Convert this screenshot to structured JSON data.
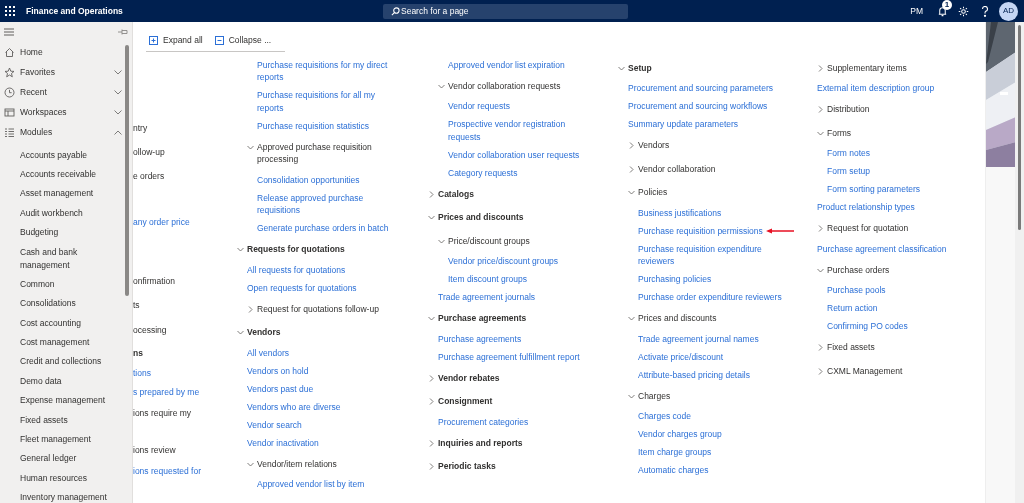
{
  "top_bar": {
    "app_title": "Finance and Operations",
    "search": {
      "placeholder": "Search for a page"
    },
    "company": "PM",
    "notification_count": "1",
    "avatar": "AD"
  },
  "sidebar": {
    "nav_items": [
      {
        "kind": "home",
        "label": "Home"
      },
      {
        "kind": "favorites",
        "label": "Favorites",
        "expanded": false
      },
      {
        "kind": "recent",
        "label": "Recent",
        "expanded": false
      },
      {
        "kind": "workspaces",
        "label": "Workspaces",
        "expanded": false
      },
      {
        "kind": "modules",
        "label": "Modules",
        "expanded": true
      }
    ],
    "modules": [
      "Accounts payable",
      "Accounts receivable",
      "Asset management",
      "Audit workbench",
      "Budgeting",
      "Cash and bank management",
      "Common",
      "Consolidations",
      "Cost accounting",
      "Cost management",
      "Credit and collections",
      "Demo data",
      "Expense management",
      "Fixed assets",
      "Fleet management",
      "General ledger",
      "Human resources",
      "Inventory management"
    ]
  },
  "toolbar": {
    "buttons": [
      {
        "kind": "expand",
        "label": "Expand all"
      },
      {
        "kind": "collapse",
        "label": "Collapse ..."
      }
    ]
  },
  "column_1_fragments": [
    {
      "kind": "text",
      "text": "ntry"
    },
    {
      "kind": "text",
      "text": "ollow-up"
    },
    {
      "kind": "text",
      "text": "e orders"
    },
    {
      "kind": "link",
      "text": "any order price"
    },
    {
      "kind": "text",
      "text": "onfirmation"
    },
    {
      "kind": "text",
      "text": "ts"
    },
    {
      "kind": "text",
      "text": "ocessing"
    },
    {
      "kind": "heading",
      "text": "ns"
    },
    {
      "kind": "link",
      "text": "tions"
    },
    {
      "kind": "link",
      "text": "s prepared by me"
    },
    {
      "kind": "text",
      "text": "ions require my"
    },
    {
      "kind": "text",
      "text": "ions review"
    },
    {
      "kind": "link",
      "text": "ions requested for"
    }
  ],
  "columns": [
    {
      "items": [
        {
          "kind": "continued",
          "children": [
            {
              "kind": "continued",
              "children": [
                {
                  "kind": "link",
                  "label": "Purchase requisitions for my direct reports"
                },
                {
                  "kind": "link",
                  "label": "Purchase requisitions for all my reports"
                },
                {
                  "kind": "link",
                  "label": "Purchase requisition statistics"
                }
              ]
            },
            {
              "kind": "group",
              "label": "Approved purchase requisition processing",
              "expanded": true,
              "children": [
                {
                  "kind": "link",
                  "label": "Consolidation opportunities"
                },
                {
                  "kind": "link",
                  "label": "Release approved purchase requisitions"
                },
                {
                  "kind": "link",
                  "label": "Generate purchase orders in batch"
                }
              ]
            }
          ]
        },
        {
          "kind": "heading",
          "label": "Requests for quotations",
          "expanded": true,
          "children": [
            {
              "kind": "link",
              "label": "All requests for quotations"
            },
            {
              "kind": "link",
              "label": "Open requests for quotations"
            },
            {
              "kind": "group",
              "label": "Request for quotations follow-up",
              "expanded": false
            }
          ]
        },
        {
          "kind": "heading",
          "label": "Vendors",
          "expanded": true,
          "children": [
            {
              "kind": "link",
              "label": "All vendors"
            },
            {
              "kind": "link",
              "label": "Vendors on hold"
            },
            {
              "kind": "link",
              "label": "Vendors past due"
            },
            {
              "kind": "link",
              "label": "Vendors who are diverse"
            },
            {
              "kind": "link",
              "label": "Vendor search"
            },
            {
              "kind": "link",
              "label": "Vendor inactivation"
            },
            {
              "kind": "group",
              "label": "Vendor/item relations",
              "expanded": true,
              "children": [
                {
                  "kind": "link",
                  "label": "Approved vendor list by item"
                }
              ]
            }
          ]
        }
      ]
    },
    {
      "items": [
        {
          "kind": "continued",
          "children": [
            {
              "kind": "continued",
              "children": [
                {
                  "kind": "link",
                  "label": "Approved vendor list expiration"
                }
              ]
            },
            {
              "kind": "group",
              "label": "Vendor collaboration requests",
              "expanded": true,
              "children": [
                {
                  "kind": "link",
                  "label": "Vendor requests"
                },
                {
                  "kind": "link",
                  "label": "Prospective vendor registration requests"
                },
                {
                  "kind": "link",
                  "label": "Vendor collaboration user requests"
                },
                {
                  "kind": "link",
                  "label": "Category requests"
                }
              ]
            }
          ]
        },
        {
          "kind": "heading",
          "label": "Catalogs",
          "expanded": false
        },
        {
          "kind": "heading",
          "label": "Prices and discounts",
          "expanded": true,
          "children": [
            {
              "kind": "group",
              "label": "Price/discount groups",
              "expanded": true,
              "children": [
                {
                  "kind": "link",
                  "label": "Vendor price/discount groups"
                },
                {
                  "kind": "link",
                  "label": "Item discount groups"
                }
              ]
            },
            {
              "kind": "link",
              "label": "Trade agreement journals"
            }
          ]
        },
        {
          "kind": "heading",
          "label": "Purchase agreements",
          "expanded": true,
          "children": [
            {
              "kind": "link",
              "label": "Purchase agreements"
            },
            {
              "kind": "link",
              "label": "Purchase agreement fulfillment report"
            }
          ]
        },
        {
          "kind": "heading",
          "label": "Vendor rebates",
          "expanded": false
        },
        {
          "kind": "heading",
          "label": "Consignment",
          "expanded": false
        },
        {
          "kind": "link",
          "label": "Procurement categories"
        },
        {
          "kind": "heading",
          "label": "Inquiries and reports",
          "expanded": false
        },
        {
          "kind": "heading",
          "label": "Periodic tasks",
          "expanded": false
        }
      ]
    },
    {
      "items": [
        {
          "kind": "heading",
          "label": "Setup",
          "expanded": true,
          "children": [
            {
              "kind": "link",
              "label": "Procurement and sourcing parameters"
            },
            {
              "kind": "link",
              "label": "Procurement and sourcing workflows"
            },
            {
              "kind": "link",
              "label": "Summary update parameters"
            },
            {
              "kind": "group",
              "label": "Vendors",
              "expanded": false
            },
            {
              "kind": "group",
              "label": "Vendor collaboration",
              "expanded": false
            },
            {
              "kind": "group",
              "label": "Policies",
              "expanded": true,
              "children": [
                {
                  "kind": "link",
                  "label": "Business justifications",
                  "annotated": false
                },
                {
                  "kind": "link",
                  "label": "Purchase requisition permissions",
                  "annotated": true
                },
                {
                  "kind": "link",
                  "label": "Purchase requisition expenditure reviewers",
                  "annotated": false
                },
                {
                  "kind": "link",
                  "label": "Purchasing policies",
                  "annotated": false
                },
                {
                  "kind": "link",
                  "label": "Purchase order expenditure reviewers",
                  "annotated": false
                }
              ]
            },
            {
              "kind": "group",
              "label": "Prices and discounts",
              "expanded": true,
              "children": [
                {
                  "kind": "link",
                  "label": "Trade agreement journal names"
                },
                {
                  "kind": "link",
                  "label": "Activate price/discount"
                },
                {
                  "kind": "link",
                  "label": "Attribute-based pricing details"
                }
              ]
            },
            {
              "kind": "group",
              "label": "Charges",
              "expanded": true,
              "children": [
                {
                  "kind": "link",
                  "label": "Charges code"
                },
                {
                  "kind": "link",
                  "label": "Vendor charges group"
                },
                {
                  "kind": "link",
                  "label": "Item charge groups"
                },
                {
                  "kind": "link",
                  "label": "Automatic charges"
                }
              ]
            }
          ]
        }
      ]
    },
    {
      "items": [
        {
          "kind": "continued",
          "children": [
            {
              "kind": "group",
              "label": "Supplementary items",
              "expanded": false
            },
            {
              "kind": "link",
              "label": "External item description group"
            },
            {
              "kind": "group",
              "label": "Distribution",
              "expanded": false
            },
            {
              "kind": "group",
              "label": "Forms",
              "expanded": true,
              "children": [
                {
                  "kind": "link",
                  "label": "Form notes"
                },
                {
                  "kind": "link",
                  "label": "Form setup"
                },
                {
                  "kind": "link",
                  "label": "Form sorting parameters"
                }
              ]
            },
            {
              "kind": "link",
              "label": "Product relationship types"
            },
            {
              "kind": "group",
              "label": "Request for quotation",
              "expanded": false
            },
            {
              "kind": "link",
              "label": "Purchase agreement classification"
            },
            {
              "kind": "group",
              "label": "Purchase orders",
              "expanded": true,
              "children": [
                {
                  "kind": "link",
                  "label": "Purchase pools"
                },
                {
                  "kind": "link",
                  "label": "Return action"
                },
                {
                  "kind": "link",
                  "label": "Confirming PO codes"
                }
              ]
            },
            {
              "kind": "group",
              "label": "Fixed assets",
              "expanded": false
            },
            {
              "kind": "group",
              "label": "CXML Management",
              "expanded": false
            }
          ]
        }
      ]
    }
  ]
}
